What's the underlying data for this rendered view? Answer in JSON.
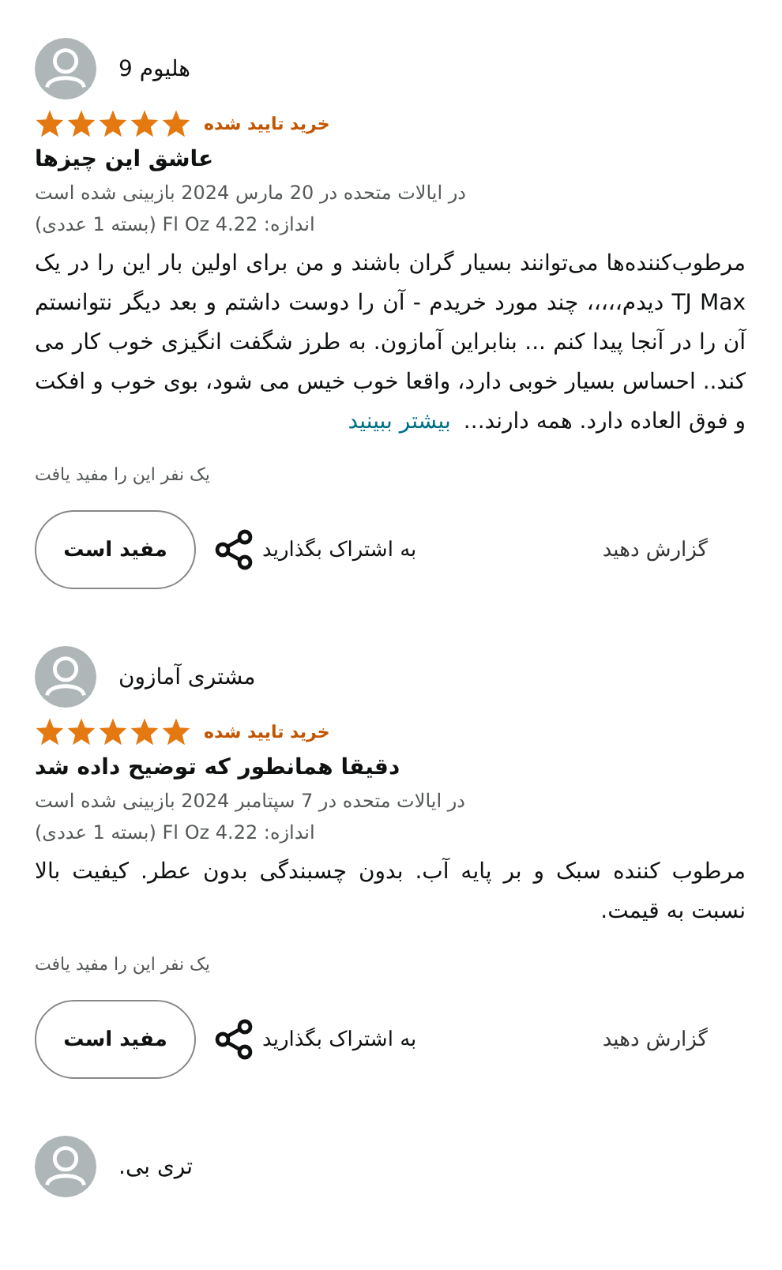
{
  "reviews": [
    {
      "name": "هلیوم 9",
      "stars": 5,
      "badge": "خرید تایید شده",
      "title": "عاشق این چیزها",
      "meta": "در ایالات متحده در 20 مارس 2024 بازبینی شده است",
      "size": "اندازه: 4.22 Fl Oz (بسته 1 عددی)",
      "body": "مرطوب‌کننده‌ها می‌توانند بسیار گران باشند و من برای اولین بار این را در یک TJ Max دیدم،،،،، چند مورد خریدم - آن را دوست داشتم و بعد دیگر نتوانستم آن را در آنجا پیدا کنم ... بنابراین آمازون. به طرز شگفت انگیزی خوب کار می کند.. احساس بسیار خوبی دارد، واقعا خوب خیس می شود، بوی خوب و افکت و فوق العاده دارد. همه دارند...",
      "more_link": "بیشتر ببینید",
      "helpful_count": "یک نفر این را مفید یافت",
      "helpful_button": "مفید است",
      "share": "به اشتراک بگذارید",
      "report": "گزارش دهید"
    },
    {
      "name": "مشتری آمازون",
      "stars": 5,
      "badge": "خرید تایید شده",
      "title": "دقیقا همانطور که توضیح داده شد",
      "meta": "در ایالات متحده در 7 سپتامبر 2024 بازبینی شده است",
      "size": "اندازه: 4.22 Fl Oz (بسته 1 عددی)",
      "body": "مرطوب کننده سبک و بر پایه آب. بدون چسبندگی بدون عطر. کیفیت بالا نسبت به قیمت.",
      "helpful_count": "یک نفر این را مفید یافت",
      "helpful_button": "مفید است",
      "share": "به اشتراک بگذارید",
      "report": "گزارش دهید"
    },
    {
      "name": "تری بی."
    }
  ]
}
